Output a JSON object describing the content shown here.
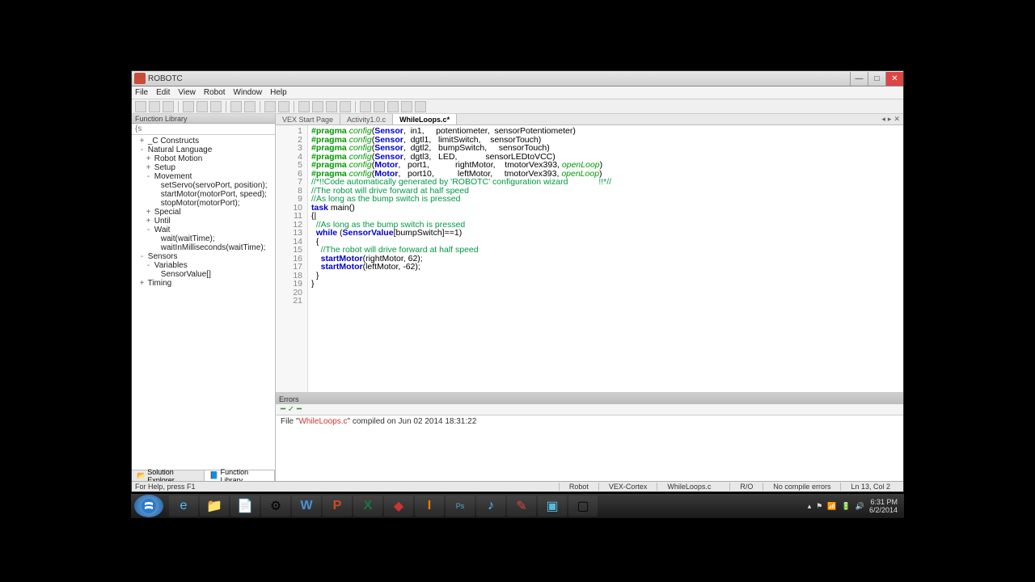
{
  "window": {
    "title": "ROBOTC"
  },
  "menu": {
    "file": "File",
    "edit": "Edit",
    "view": "View",
    "robot": "Robot",
    "window": "Window",
    "help": "Help"
  },
  "sidebar": {
    "title": "Function Library",
    "search_placeholder": "{s",
    "tree": [
      {
        "label": "_C Constructs",
        "lvl": 0,
        "exp": "+"
      },
      {
        "label": "Natural Language",
        "lvl": 0,
        "exp": "-"
      },
      {
        "label": "Robot Motion",
        "lvl": 1,
        "exp": "+"
      },
      {
        "label": "Setup",
        "lvl": 1,
        "exp": "+"
      },
      {
        "label": "Movement",
        "lvl": 1,
        "exp": "-"
      },
      {
        "label": "setServo(servoPort, position);",
        "lvl": 2,
        "exp": ""
      },
      {
        "label": "startMotor(motorPort, speed);",
        "lvl": 2,
        "exp": ""
      },
      {
        "label": "stopMotor(motorPort);",
        "lvl": 2,
        "exp": ""
      },
      {
        "label": "Special",
        "lvl": 1,
        "exp": "+"
      },
      {
        "label": "Until",
        "lvl": 1,
        "exp": "+"
      },
      {
        "label": "Wait",
        "lvl": 1,
        "exp": "-"
      },
      {
        "label": "wait(waitTime);",
        "lvl": 2,
        "exp": ""
      },
      {
        "label": "waitInMilliseconds(waitTime);",
        "lvl": 2,
        "exp": ""
      },
      {
        "label": "Sensors",
        "lvl": 0,
        "exp": "-"
      },
      {
        "label": "Variables",
        "lvl": 1,
        "exp": "-"
      },
      {
        "label": "SensorValue[]",
        "lvl": 2,
        "exp": ""
      },
      {
        "label": "Timing",
        "lvl": 0,
        "exp": "+"
      }
    ],
    "tabs": {
      "solution": "Solution Explorer",
      "functions": "Function Library"
    }
  },
  "tabs": {
    "t1": "VEX Start Page",
    "t2": "Activity1.0.c",
    "t3": "WhileLoops.c*"
  },
  "code": {
    "lines": 21,
    "l1": {
      "a": "#pragma",
      "b": " config",
      "c": "(",
      "d": "Sensor",
      "e": ",  in1,     potentiometer,  sensorPotentiometer)"
    },
    "l2": {
      "a": "#pragma",
      "b": " config",
      "c": "(",
      "d": "Sensor",
      "e": ",  dgtl1,   limitSwitch,    sensorTouch)"
    },
    "l3": {
      "a": "#pragma",
      "b": " config",
      "c": "(",
      "d": "Sensor",
      "e": ",  dgtl2,   bumpSwitch,     sensorTouch)"
    },
    "l4": {
      "a": "#pragma",
      "b": " config",
      "c": "(",
      "d": "Sensor",
      "e": ",  dgtl3,   LED,            sensorLEDtoVCC)"
    },
    "l5": {
      "a": "#pragma",
      "b": " config",
      "c": "(",
      "d": "Motor",
      "e": ",   port1,           rightMotor,    tmotorVex393, ",
      "f": "openLoop",
      "g": ")"
    },
    "l6": {
      "a": "#pragma",
      "b": " config",
      "c": "(",
      "d": "Motor",
      "e": ",   port10,          leftMotor,     tmotorVex393, ",
      "f": "openLoop",
      "g": ")"
    },
    "l7": "//*!!Code automatically generated by 'ROBOTC' configuration wizard             !!*//",
    "l9": "//The robot will drive forward at half speed",
    "l10": "//As long as the bump switch is pressed",
    "l12": {
      "a": "task",
      "b": " main",
      "c": "()"
    },
    "l13": "{|",
    "l14": "  //As long as the bump switch is pressed",
    "l15": {
      "a": "  ",
      "b": "while",
      "c": " (",
      "d": "SensorValue",
      "e": "[bumpSwitch]==1)"
    },
    "l16": "  {",
    "l17": "    //The robot will drive forward at half speed",
    "l18": {
      "a": "    ",
      "b": "startMotor",
      "c": "(rightMotor, 62);"
    },
    "l19": {
      "a": "    ",
      "b": "startMotor",
      "c": "(leftMotor, -62);"
    },
    "l20": "  }",
    "l21": "}"
  },
  "errors": {
    "title": "Errors",
    "msg_pre": "File \"",
    "msg_file": "WhileLoops.c",
    "msg_post": "\" compiled on Jun 02 2014 18:31:22"
  },
  "status": {
    "help": "For Help, press F1",
    "robot": "Robot",
    "platform": "VEX-Cortex",
    "file": "WhileLoops.c",
    "ro": "R/O",
    "compile": "No compile errors",
    "pos": "Ln 13, Col 2"
  },
  "tray": {
    "time": "6:31 PM",
    "date": "6/2/2014"
  }
}
